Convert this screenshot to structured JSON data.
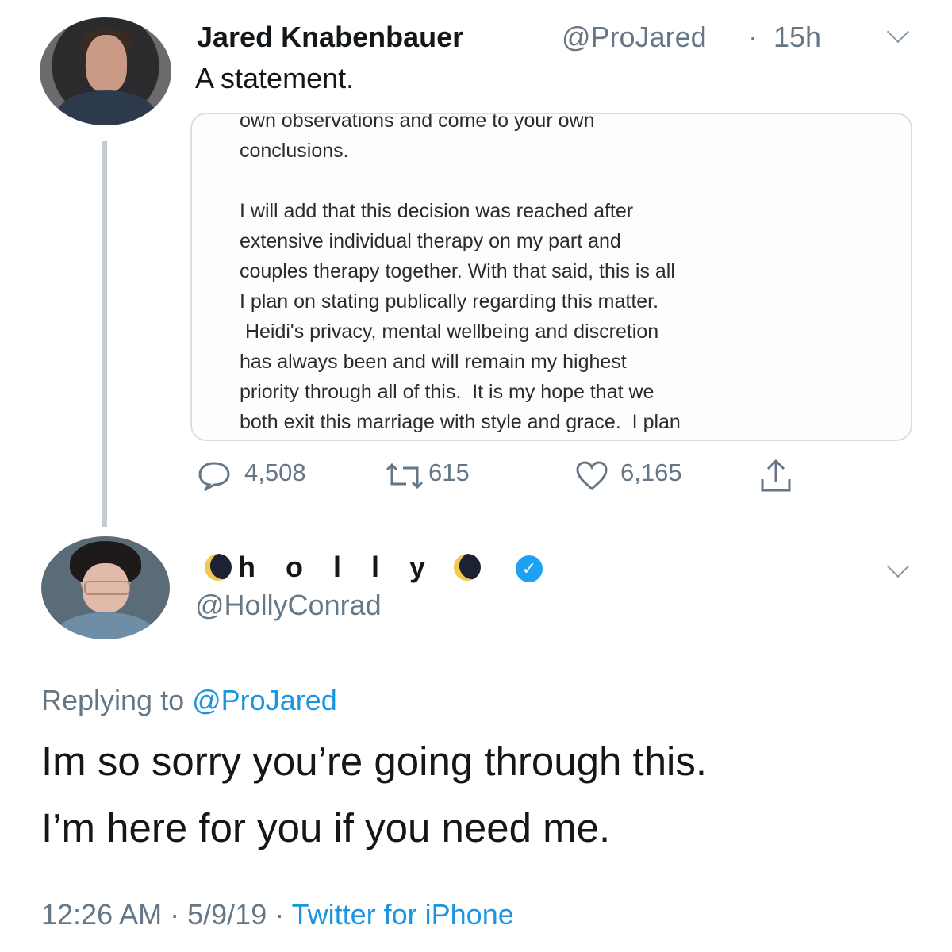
{
  "original_tweet": {
    "author_name": "Jared Knabenbauer",
    "author_handle": "@ProJared",
    "separator": "·",
    "time_ago": "15h",
    "text": "A statement.",
    "statement_lines": [
      "own observations and come to your own",
      "conclusions.",
      "",
      "I will add that this decision was reached after",
      "extensive individual therapy on my part and",
      "couples therapy together.  With that said, this is all",
      "I plan on stating publically regarding this matter.",
      " Heidi's privacy, mental wellbeing and discretion",
      "has always been and will remain my highest",
      "priority through all of this.  It is my hope that we",
      "both exit this marriage with style and grace.  I plan"
    ],
    "actions": {
      "reply_count": "4,508",
      "retweet_count": "615",
      "like_count": "6,165",
      "reply_icon": "speech-bubble-icon",
      "retweet_icon": "retweet-icon",
      "like_icon": "heart-icon",
      "share_icon": "share-icon"
    }
  },
  "reply_tweet": {
    "display_name": "h o l l y",
    "name_emoji": "moon-emoji",
    "verified": true,
    "author_handle": "@HollyConrad",
    "replying_prefix": "Replying to",
    "replying_to": "@ProJared",
    "text_line1": "Im so sorry you’re going through this.",
    "text_line2": "I’m here for you if you need me.",
    "time": "12:26 AM",
    "date": "5/9/19",
    "separator": "·",
    "source": "Twitter for iPhone"
  },
  "colors": {
    "link_blue": "#1b95e0",
    "muted_gray": "#657786",
    "verified_blue": "#1da1f2",
    "text_dark": "#14171a"
  }
}
